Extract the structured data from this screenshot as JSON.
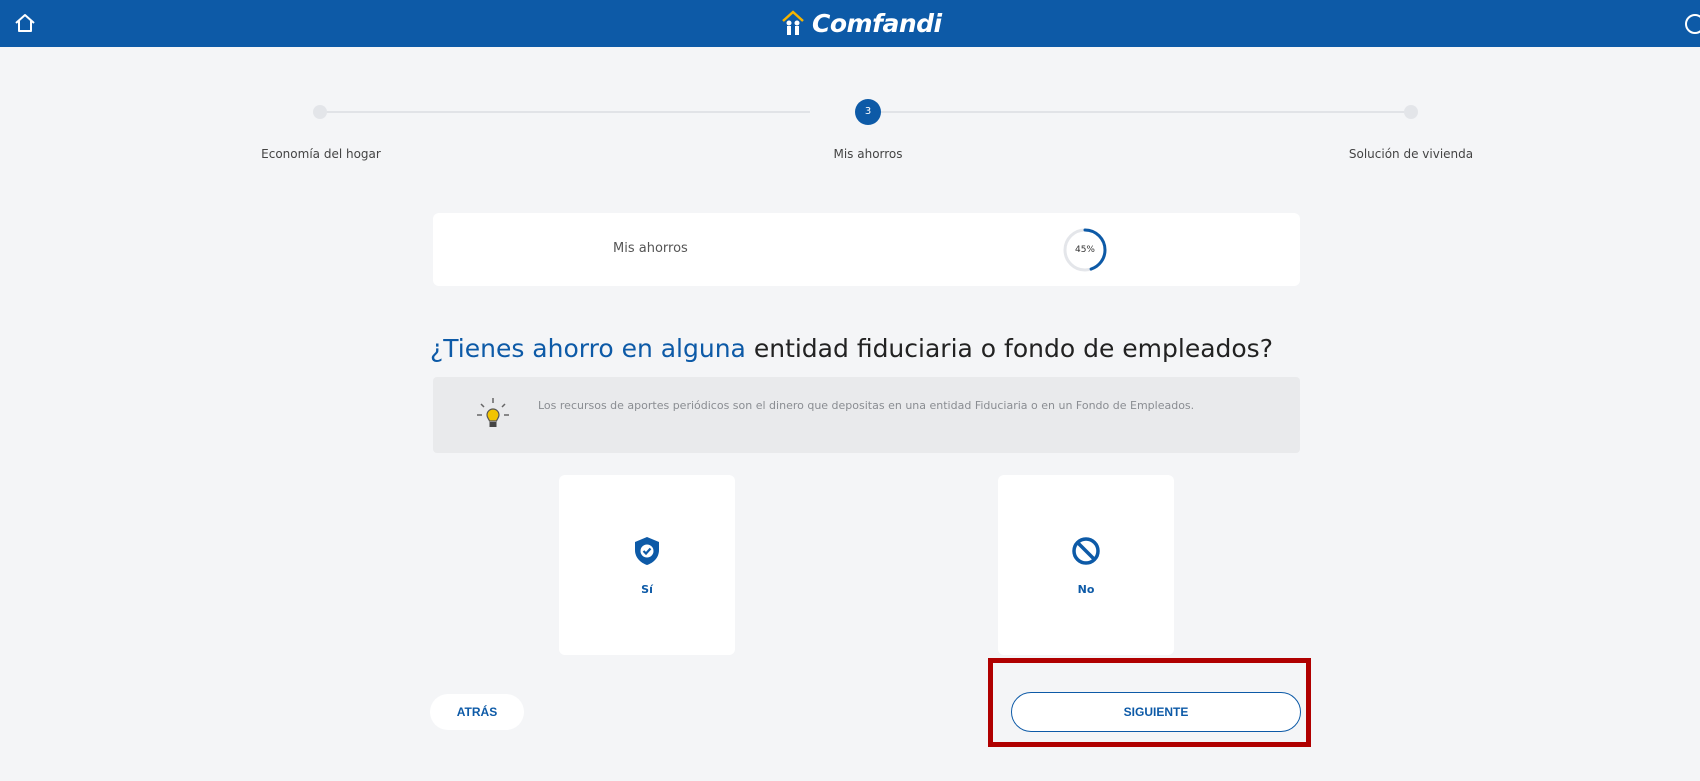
{
  "header": {
    "brand": "Comfandi",
    "brand_color": "#0d5aa7",
    "home_icon": "home-icon",
    "exit_icon": "logout-icon"
  },
  "stepper": {
    "steps": [
      {
        "label": "Economía del hogar",
        "state": "done"
      },
      {
        "label": "Mis ahorros",
        "state": "active",
        "number": "3"
      },
      {
        "label": "Solución de vivienda",
        "state": "pending"
      }
    ]
  },
  "progress": {
    "title": "Mis ahorros",
    "percent_label": "45%",
    "percent": 45
  },
  "question": {
    "highlight": "¿Tienes ahorro en alguna",
    "rest": " entidad fiduciaria o fondo de empleados?"
  },
  "tip": {
    "icon": "lightbulb-icon",
    "text": "Los recursos de aportes periódicos son el dinero que depositas en una entidad Fiduciaria o en un Fondo de Empleados."
  },
  "options": [
    {
      "label": "Sí",
      "icon": "shield-check-icon"
    },
    {
      "label": "No",
      "icon": "forbidden-icon"
    }
  ],
  "actions": {
    "back_label": "ATRÁS",
    "next_label": "SIGUIENTE"
  },
  "annotation_color": "#b00000"
}
